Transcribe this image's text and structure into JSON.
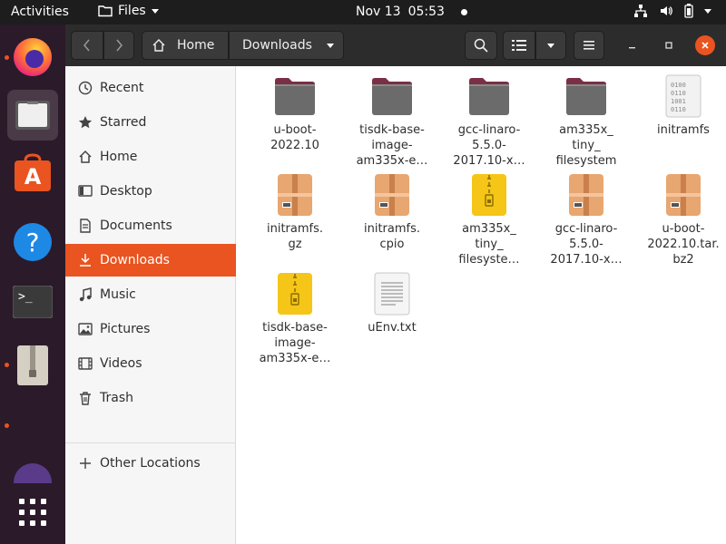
{
  "topbar": {
    "activities": "Activities",
    "app_menu": "Files",
    "date": "Nov 13",
    "time": "05:53"
  },
  "dock": {
    "apps": [
      {
        "name": "firefox-icon"
      },
      {
        "name": "files-icon"
      },
      {
        "name": "software-icon"
      },
      {
        "name": "help-icon"
      },
      {
        "name": "terminal-icon"
      },
      {
        "name": "archive-manager-icon"
      },
      {
        "name": "show-apps-icon"
      }
    ]
  },
  "header": {
    "path": [
      "Home",
      "Downloads"
    ]
  },
  "sidebar": {
    "items": [
      {
        "label": "Recent",
        "icon": "clock-icon"
      },
      {
        "label": "Starred",
        "icon": "star-icon"
      },
      {
        "label": "Home",
        "icon": "home-icon"
      },
      {
        "label": "Desktop",
        "icon": "desktop-icon"
      },
      {
        "label": "Documents",
        "icon": "document-icon"
      },
      {
        "label": "Downloads",
        "icon": "download-icon",
        "selected": true
      },
      {
        "label": "Music",
        "icon": "music-icon"
      },
      {
        "label": "Pictures",
        "icon": "picture-icon"
      },
      {
        "label": "Videos",
        "icon": "video-icon"
      },
      {
        "label": "Trash",
        "icon": "trash-icon"
      }
    ],
    "other_locations": "Other Locations"
  },
  "files": [
    {
      "name": "u-boot-\n2022.10",
      "type": "folder"
    },
    {
      "name": "tisdk-base-\nimage-\nam335x-e…",
      "type": "folder"
    },
    {
      "name": "gcc-linaro-\n5.5.0-\n2017.10-x…",
      "type": "folder"
    },
    {
      "name": "am335x_\ntiny_\nfilesystem",
      "type": "folder"
    },
    {
      "name": "initramfs",
      "type": "binary"
    },
    {
      "name": "initramfs.\ngz",
      "type": "archive"
    },
    {
      "name": "initramfs.\ncpio",
      "type": "archive"
    },
    {
      "name": "am335x_\ntiny_\nfilesyste…",
      "type": "zip"
    },
    {
      "name": "gcc-linaro-\n5.5.0-\n2017.10-x…",
      "type": "archive"
    },
    {
      "name": "u-boot-\n2022.10.tar.\nbz2",
      "type": "archive"
    },
    {
      "name": "tisdk-base-\nimage-\nam335x-e…",
      "type": "zip"
    },
    {
      "name": "uEnv.txt",
      "type": "text"
    }
  ],
  "colors": {
    "accent": "#e95420",
    "folder": "#6b6b6b",
    "folder_tab": "#7a2f45",
    "archive": "#e8a670",
    "zip": "#f5c518"
  }
}
